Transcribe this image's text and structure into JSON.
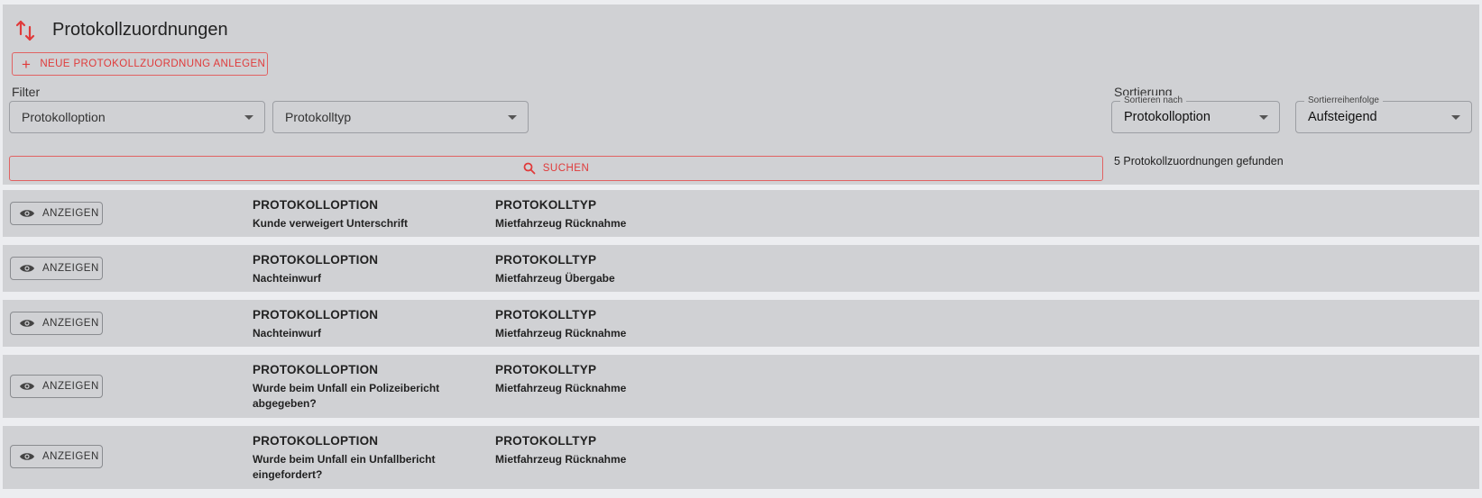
{
  "header": {
    "title": "Protokollzuordnungen",
    "new_button_label": "NEUE PROTOKOLLZUORDNUNG ANLEGEN"
  },
  "filter": {
    "label": "Filter",
    "option_placeholder": "Protokolloption",
    "type_placeholder": "Protokolltyp",
    "search_label": "SUCHEN"
  },
  "sort": {
    "label": "Sortierung",
    "by_label": "Sortieren nach",
    "by_value": "Protokolloption",
    "order_label": "Sortierreihenfolge",
    "order_value": "Aufsteigend",
    "result_text": "5 Protokollzuordnungen gefunden"
  },
  "columns": {
    "option_header": "PROTOKOLLOPTION",
    "type_header": "PROTOKOLLTYP",
    "show_label": "ANZEIGEN"
  },
  "rows": [
    {
      "option": "Kunde verweigert Unterschrift",
      "type": "Mietfahrzeug Rücknahme"
    },
    {
      "option": "Nachteinwurf",
      "type": "Mietfahrzeug Übergabe"
    },
    {
      "option": "Nachteinwurf",
      "type": "Mietfahrzeug Rücknahme"
    },
    {
      "option": "Wurde beim Unfall ein Polizeibericht abgegeben?",
      "type": "Mietfahrzeug Rücknahme"
    },
    {
      "option": "Wurde beim Unfall ein Unfallbericht eingefordert?",
      "type": "Mietfahrzeug Rücknahme"
    }
  ],
  "colors": {
    "accent": "#e03a3a",
    "panel": "#d0d1d4",
    "background": "#ecedf0"
  },
  "icons": {
    "title": "swap-vertical-icon",
    "new": "plus-icon",
    "search": "search-icon",
    "show": "eye-icon"
  }
}
